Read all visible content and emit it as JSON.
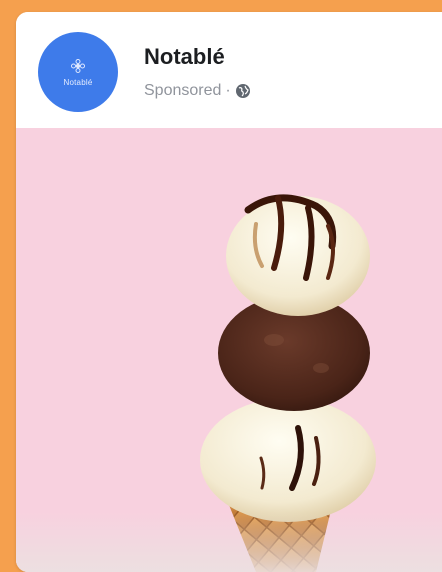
{
  "post": {
    "page_name": "Notablé",
    "sponsored_label": "Sponsored",
    "separator": "·",
    "avatar_text": "Notablé",
    "avatar_color": "#3e7bea",
    "privacy_icon": "globe-icon"
  },
  "colors": {
    "page_background": "#f5a04e",
    "media_background": "#f8d1df"
  },
  "media": {
    "subject_icon": "ice-cream-cone-icon"
  }
}
